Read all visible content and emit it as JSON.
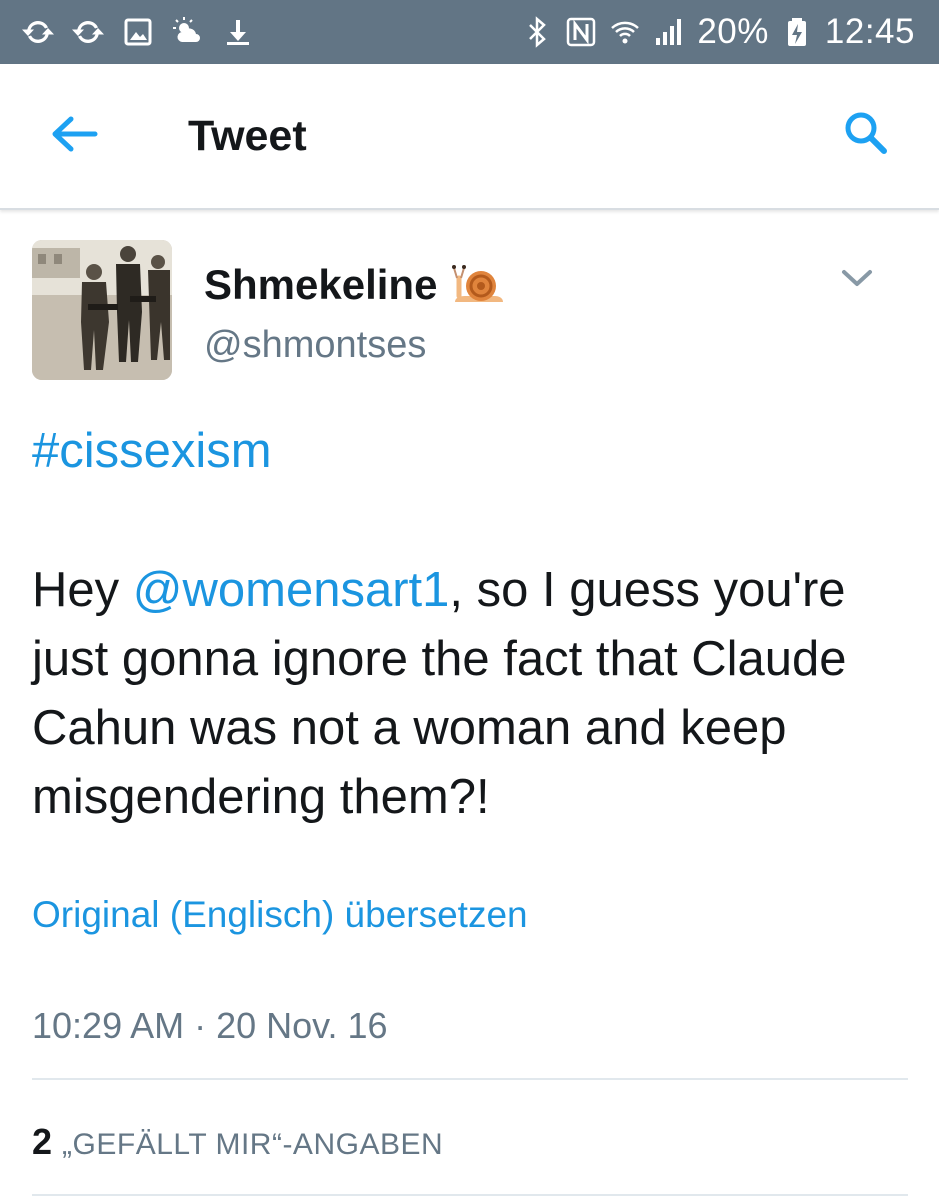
{
  "status_bar": {
    "left_icons": [
      "sync-icon",
      "sync-icon",
      "image-icon",
      "weather-icon",
      "download-icon"
    ],
    "right_icons": [
      "bluetooth-icon",
      "nfc-icon",
      "wifi-icon",
      "signal-icon",
      "battery-charging-icon"
    ],
    "battery_percent": "20%",
    "time": "12:45",
    "background_color": "#627585"
  },
  "app_bar": {
    "back_icon": "arrow-left-icon",
    "title": "Tweet",
    "search_icon": "search-icon",
    "accent_color": "#1da1f2"
  },
  "tweet": {
    "author": {
      "display_name": "Shmekeline",
      "emoji": "snail",
      "handle": "@shmontses"
    },
    "menu_icon": "chevron-down-icon",
    "hashtag": "#cissexism",
    "text_before_mention": "Hey ",
    "mention": "@womensart1",
    "text_after_mention": ", so I guess you're just gonna ignore the fact that Claude Cahun was not a woman and keep misgendering them?!",
    "translate_link": "Original (Englisch) übersetzen",
    "timestamp": "10:29 AM · 20 Nov. 16",
    "likes": {
      "count": "2",
      "label": "„GEFÄLLT MIR“-ANGABEN"
    },
    "link_color": "#1b95e0"
  }
}
